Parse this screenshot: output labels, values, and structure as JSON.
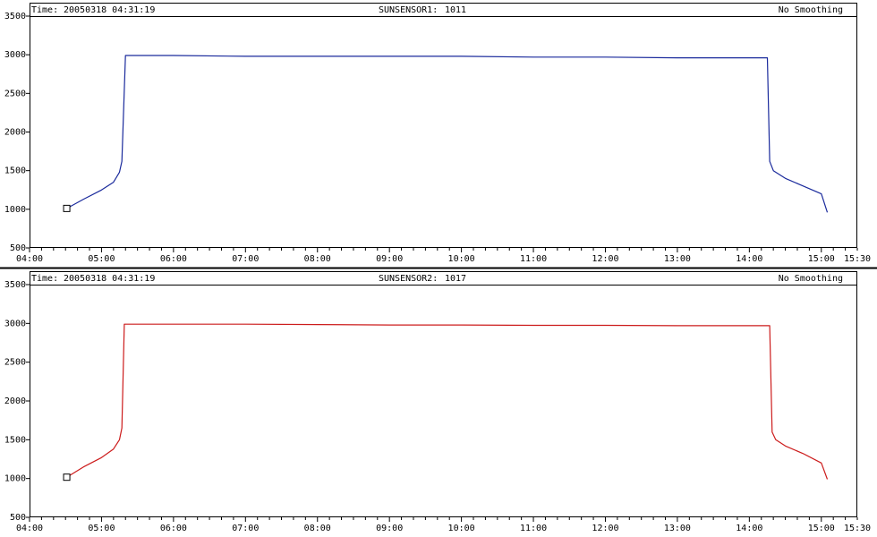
{
  "panels": [
    {
      "time_label": "Time:",
      "time_value": "20050318 04:31:19",
      "sensor_name": "SUNSENSOR1:",
      "sensor_value": "1011",
      "smoothing": "No Smoothing",
      "colors": {
        "line": "#1a2a9c"
      }
    },
    {
      "time_label": "Time:",
      "time_value": "20050318 04:31:19",
      "sensor_name": "SUNSENSOR2:",
      "sensor_value": "1017",
      "smoothing": "No Smoothing",
      "colors": {
        "line": "#cc1b1b",
        "sensor_name": "#cc1b1b"
      }
    }
  ],
  "chart_data": [
    {
      "type": "line",
      "series": [
        {
          "name": "SUNSENSOR1",
          "x": [
            "04:31",
            "04:45",
            "05:00",
            "05:10",
            "05:15",
            "05:17",
            "05:20",
            "06:00",
            "07:00",
            "08:00",
            "09:00",
            "10:00",
            "11:00",
            "12:00",
            "13:00",
            "14:00",
            "14:15",
            "14:17",
            "14:20",
            "14:30",
            "14:45",
            "15:00",
            "15:05"
          ],
          "y": [
            1011,
            1130,
            1250,
            1350,
            1480,
            1620,
            2990,
            2990,
            2980,
            2980,
            2980,
            2980,
            2970,
            2970,
            2960,
            2960,
            2960,
            1620,
            1500,
            1400,
            1300,
            1200,
            960
          ]
        }
      ],
      "x_ticks": [
        "04:00",
        "05:00",
        "06:00",
        "07:00",
        "08:00",
        "09:00",
        "10:00",
        "11:00",
        "12:00",
        "13:00",
        "14:00",
        "15:00",
        "15:30"
      ],
      "y_ticks": [
        "500",
        "1000",
        "1500",
        "2000",
        "2500",
        "3000",
        "3500"
      ],
      "xlim": [
        "04:00",
        "15:30"
      ],
      "ylim": [
        500,
        3500
      ],
      "marker": {
        "x": "04:31",
        "y": 1011
      },
      "grid": false
    },
    {
      "type": "line",
      "series": [
        {
          "name": "SUNSENSOR2",
          "x": [
            "04:31",
            "04:45",
            "05:00",
            "05:10",
            "05:15",
            "05:17",
            "05:19",
            "06:00",
            "07:00",
            "08:00",
            "09:00",
            "10:00",
            "11:00",
            "12:00",
            "13:00",
            "14:00",
            "14:17",
            "14:19",
            "14:22",
            "14:30",
            "14:45",
            "15:00",
            "15:05"
          ],
          "y": [
            1017,
            1150,
            1270,
            1380,
            1500,
            1650,
            2990,
            2990,
            2990,
            2985,
            2980,
            2980,
            2975,
            2975,
            2970,
            2970,
            2970,
            1600,
            1500,
            1420,
            1320,
            1200,
            990
          ]
        }
      ],
      "x_ticks": [
        "04:00",
        "05:00",
        "06:00",
        "07:00",
        "08:00",
        "09:00",
        "10:00",
        "11:00",
        "12:00",
        "13:00",
        "14:00",
        "15:00",
        "15:30"
      ],
      "y_ticks": [
        "500",
        "1000",
        "1500",
        "2000",
        "2500",
        "3000",
        "3500"
      ],
      "xlim": [
        "04:00",
        "15:30"
      ],
      "ylim": [
        500,
        3500
      ],
      "marker": {
        "x": "04:31",
        "y": 1017
      },
      "grid": false
    }
  ]
}
